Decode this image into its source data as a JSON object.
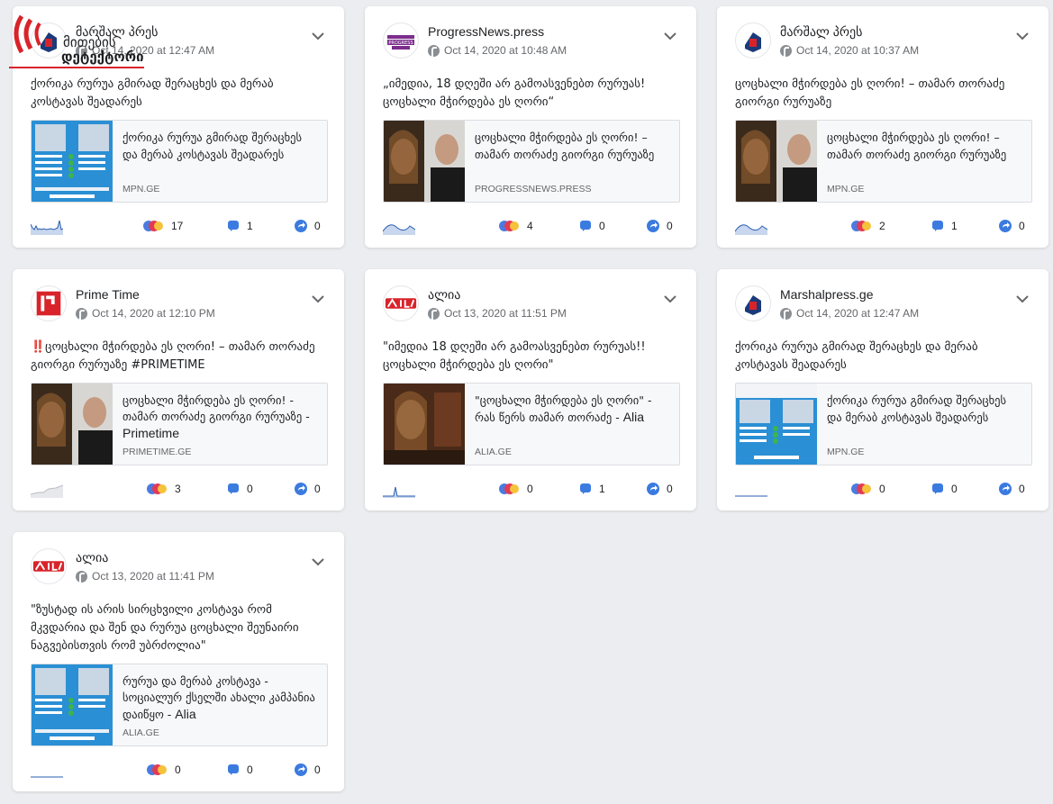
{
  "overlay_logo": {
    "line1": "მითების",
    "line2": "დეტექტორი",
    "color": "#d9232a"
  },
  "posts": [
    {
      "page": "მარშალ პრეს",
      "time": "Oct 14, 2020 at 12:47 AM",
      "avatar": "mpn",
      "message": "ქორიკა რურუა გმირად შერაცხეს და მერაბ კოსტავას შეადარეს",
      "link_title": "ქორიკა რურუა გმირად შერაცხეს და მერაბ კოსტავას შეადარეს",
      "link_title_suffix": "",
      "link_domain": "MPN.GE",
      "thumb": "infographic",
      "reactions": "17",
      "comments": "1",
      "shares": "0",
      "spark": "busy"
    },
    {
      "page": "ProgressNews.press",
      "time": "Oct 14, 2020 at 10:48 AM",
      "avatar": "progress",
      "message": "„იმედია, 18 დღეში არ გამოასვენებთ რურუას! ცოცხალი მჭირდება ეს ღორი“",
      "link_title": "ცოცხალი მჭირდება ეს ღორი! – თამარ თორაძე გიორგი რურუაზე",
      "link_title_suffix": "",
      "link_domain": "PROGRESSNEWS.PRESS",
      "thumb": "photo2",
      "reactions": "4",
      "comments": "0",
      "shares": "0",
      "spark": "wave"
    },
    {
      "page": "მარშალ პრეს",
      "time": "Oct 14, 2020 at 10:37 AM",
      "avatar": "mpn",
      "message": "ცოცხალი მჭირდება ეს ღორი! – თამარ თორაძე გიორგი რურუაზე",
      "link_title": "ცოცხალი მჭირდება ეს ღორი! – თამარ თორაძე გიორგი რურუაზე",
      "link_title_suffix": "",
      "link_domain": "MPN.GE",
      "thumb": "photo2",
      "reactions": "2",
      "comments": "1",
      "shares": "0",
      "spark": "wave"
    },
    {
      "page": "Prime Time",
      "time": "Oct 14, 2020 at 12:10 PM",
      "avatar": "prime",
      "message": "‼️ცოცხალი მჭირდება ეს ღორი! – თამარ თორაძე გიორგი რურუაზე #PRIMETIME",
      "link_title": "ცოცხალი მჭირდება ეს ღორი! - თამარ თორაძე გიორგი რურუაზე - ",
      "link_title_suffix": "Primetime",
      "link_domain": "PRIMETIME.GE",
      "thumb": "photo2",
      "reactions": "3",
      "comments": "0",
      "shares": "0",
      "spark": "flat"
    },
    {
      "page": "ალია",
      "time": "Oct 13, 2020 at 11:51 PM",
      "avatar": "alia",
      "message": "\"იმედია 18 დღეში არ გამოასვენებთ რურუას!! ცოცხალი მჭირდება ეს ღორი\"",
      "link_title": "\"ცოცხალი მჭირდება ეს ღორი\" - რას წერს თამარ თორაძე - ",
      "link_title_suffix": "Alia",
      "link_domain": "ALIA.GE",
      "thumb": "photo1",
      "reactions": "0",
      "comments": "1",
      "shares": "0",
      "spark": "spike"
    },
    {
      "page": "Marshalpress.ge",
      "time": "Oct 14, 2020 at 12:47 AM",
      "avatar": "mpn",
      "message": "ქორიკა რურუა გმირად შერაცხეს და მერაბ კოსტავას შეადარეს",
      "link_title": "ქორიკა რურუა გმირად შერაცხეს და მერაბ კოსტავას შეადარეს",
      "link_title_suffix": "",
      "link_domain": "MPN.GE",
      "thumb": "infographic",
      "reactions": "0",
      "comments": "0",
      "shares": "0",
      "spark": "line"
    },
    {
      "page": "ალია",
      "time": "Oct 13, 2020 at 11:41 PM",
      "avatar": "alia",
      "message": "\"ზუსტად ის არის სირცხვილი კოსტავა რომ მკვდარია და შენ და რურუა ცოცხალი შეუნაირი ნაგვებისთვის რომ უბრძოლია\"",
      "link_title": "რურუა და მერაბ კოსტავა - სოციალურ ქსელში ახალი კამპანია დაიწყო - ",
      "link_title_suffix": "Alia",
      "link_domain": "ALIA.GE",
      "thumb": "infographic",
      "reactions": "0",
      "comments": "0",
      "shares": "0",
      "spark": "line"
    }
  ]
}
